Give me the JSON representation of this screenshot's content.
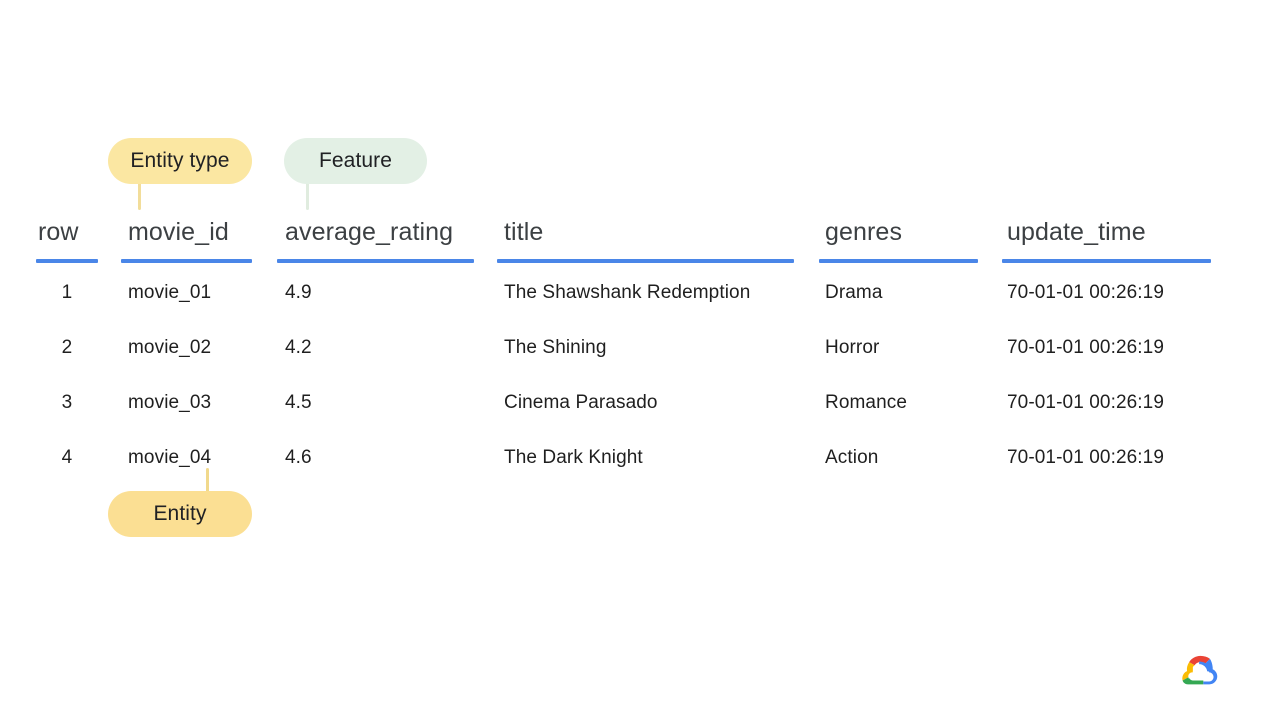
{
  "callouts": [
    {
      "id": "entity-type",
      "label": "Entity type",
      "color": "#fbe7a2",
      "stem_color": "#f2dd9a"
    },
    {
      "id": "feature",
      "label": "Feature",
      "color": "#e3f0e5",
      "stem_color": "#e0ecdf"
    },
    {
      "id": "entity",
      "label": "Entity",
      "color": "#fbdf93",
      "stem_color": "#f1d98c"
    }
  ],
  "table": {
    "rule_color": "#4a86e8",
    "columns": [
      {
        "key": "row",
        "header": "row"
      },
      {
        "key": "movie_id",
        "header": "movie_id"
      },
      {
        "key": "average_rating",
        "header": "average_rating"
      },
      {
        "key": "title",
        "header": "title"
      },
      {
        "key": "genres",
        "header": "genres"
      },
      {
        "key": "update_time",
        "header": "update_time"
      }
    ],
    "rows": [
      {
        "row": "1",
        "movie_id": "movie_01",
        "average_rating": "4.9",
        "title": "The Shawshank Redemption",
        "genres": "Drama",
        "update_time": "70-01-01 00:26:19"
      },
      {
        "row": "2",
        "movie_id": "movie_02",
        "average_rating": "4.2",
        "title": "The Shining",
        "genres": "Horror",
        "update_time": "70-01-01 00:26:19"
      },
      {
        "row": "3",
        "movie_id": "movie_03",
        "average_rating": "4.5",
        "title": "Cinema Parasado",
        "genres": "Romance",
        "update_time": "70-01-01 00:26:19"
      },
      {
        "row": "4",
        "movie_id": "movie_04",
        "average_rating": "4.6",
        "title": "The Dark Knight",
        "genres": "Action",
        "update_time": "70-01-01 00:26:19"
      }
    ]
  },
  "branding": {
    "logo": "google-cloud-logo",
    "colors": {
      "red": "#ea4335",
      "yellow": "#fbbc04",
      "green": "#34a853",
      "blue": "#4285f4"
    }
  }
}
